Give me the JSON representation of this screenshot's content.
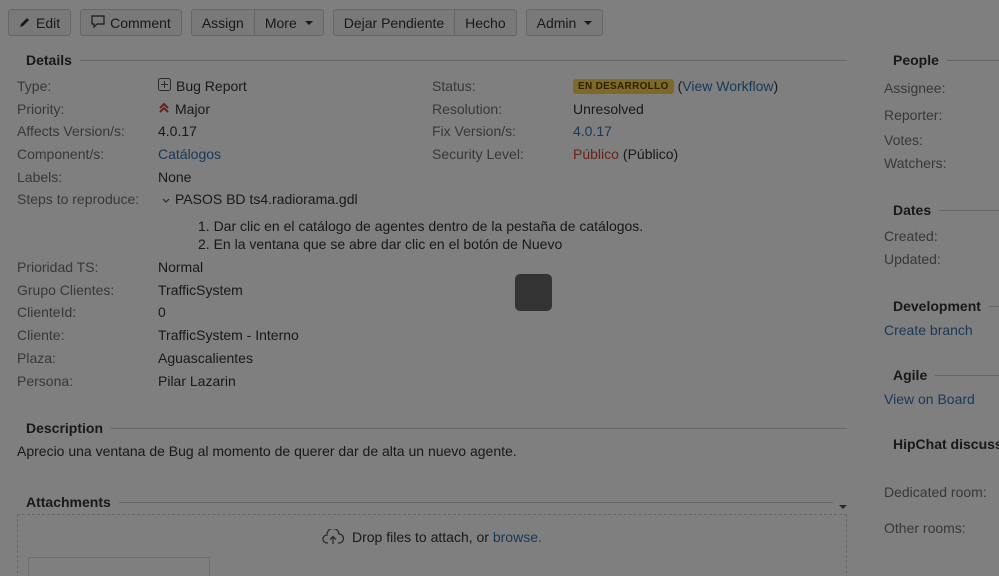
{
  "toolbar": {
    "edit": "Edit",
    "comment": "Comment",
    "assign": "Assign",
    "more": "More",
    "dejar_pendiente": "Dejar Pendiente",
    "hecho": "Hecho",
    "admin": "Admin"
  },
  "details": {
    "title": "Details",
    "type": {
      "label": "Type:",
      "value": "Bug Report"
    },
    "priority": {
      "label": "Priority:",
      "value": "Major"
    },
    "affects": {
      "label": "Affects Version/s:",
      "value": "4.0.17"
    },
    "component": {
      "label": "Component/s:",
      "value": "Catálogos"
    },
    "labels": {
      "label": "Labels:",
      "value": "None"
    },
    "steps": {
      "label": "Steps to reproduce:",
      "value": "PASOS BD ts4.radiorama.gdl",
      "items": [
        "1. Dar clic en el catálogo de agentes dentro de la pestaña de catálogos.",
        "2. En la ventana que se abre dar clic en el botón de Nuevo"
      ]
    },
    "prioridad_ts": {
      "label": "Prioridad TS:",
      "value": "Normal"
    },
    "grupo": {
      "label": "Grupo Clientes:",
      "value": "TrafficSystem"
    },
    "clienteid": {
      "label": "ClienteId:",
      "value": "0"
    },
    "cliente": {
      "label": "Cliente:",
      "value": "TrafficSystem - Interno"
    },
    "plaza": {
      "label": "Plaza:",
      "value": "Aguascalientes"
    },
    "persona": {
      "label": "Persona:",
      "value": "Pilar Lazarin"
    },
    "status": {
      "label": "Status:",
      "value": "EN DESARROLLO",
      "workflow_open": "(",
      "workflow": "View Workflow",
      "workflow_close": ")"
    },
    "resolution": {
      "label": "Resolution:",
      "value": "Unresolved"
    },
    "fix": {
      "label": "Fix Version/s:",
      "value": "4.0.17"
    },
    "security": {
      "label": "Security Level:",
      "value": "Público",
      "extra": "(Público)"
    }
  },
  "description": {
    "title": "Description",
    "text": "Aprecio una ventana de Bug al momento de querer dar de alta un nuevo agente."
  },
  "attachments": {
    "title": "Attachments",
    "drop_text": "Drop files to attach, or",
    "browse": "browse."
  },
  "sidebar": {
    "people": {
      "title": "People",
      "assignee": "Assignee:",
      "reporter": "Reporter:",
      "votes": "Votes:",
      "watchers": "Watchers:"
    },
    "dates": {
      "title": "Dates",
      "created": "Created:",
      "updated": "Updated:"
    },
    "development": {
      "title": "Development",
      "create_branch": "Create branch"
    },
    "agile": {
      "title": "Agile",
      "view_on_board": "View on Board"
    },
    "hipchat": {
      "title": "HipChat discussio",
      "dedicated": "Dedicated room:",
      "other": "Other rooms:"
    }
  },
  "colors": {
    "link": "#3572b0",
    "badge_bg": "#ffd351",
    "public_red": "#d04437",
    "overlay": "#000000"
  }
}
